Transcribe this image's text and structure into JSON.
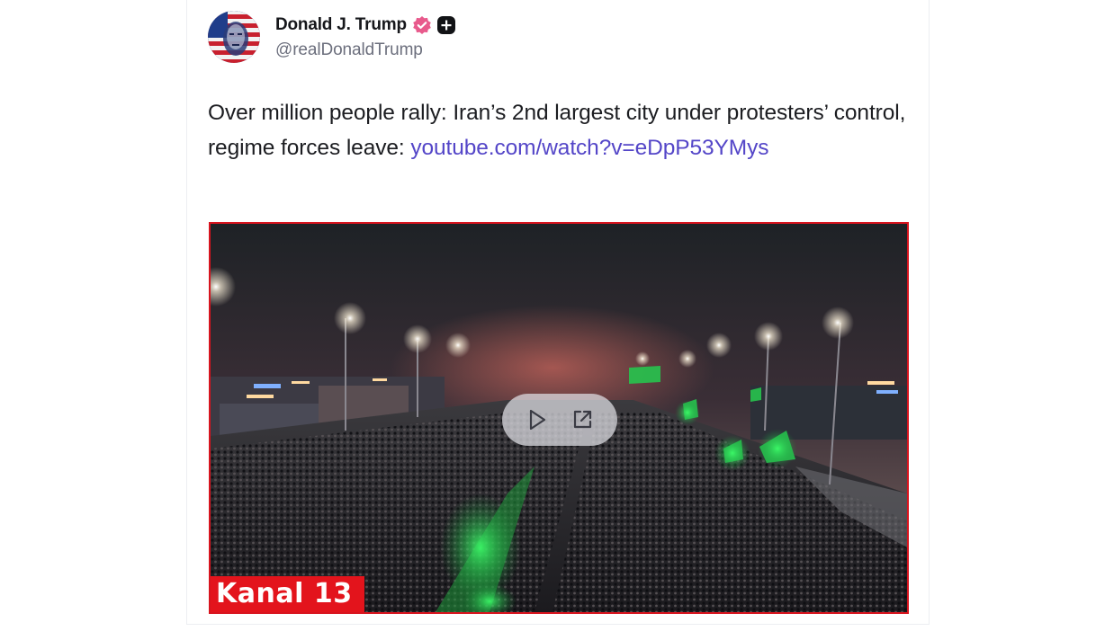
{
  "post": {
    "author": {
      "display_name": "Donald J. Trump",
      "handle": "@realDonaldTrump",
      "verified": true,
      "verified_badge_color": "#e85a8c"
    },
    "text": "Over million people rally: Iran’s 2nd largest city under protesters’ control, regime forces leave: ",
    "link": {
      "text": "youtube.com/watch?v=eDpP53YMys",
      "color": "#5446c8"
    },
    "media": {
      "type": "video",
      "watermark": "Kanal 13",
      "border_color": "#d8141e",
      "controls": {
        "play_icon": "play-icon",
        "open_external_icon": "external-link-icon"
      }
    }
  }
}
